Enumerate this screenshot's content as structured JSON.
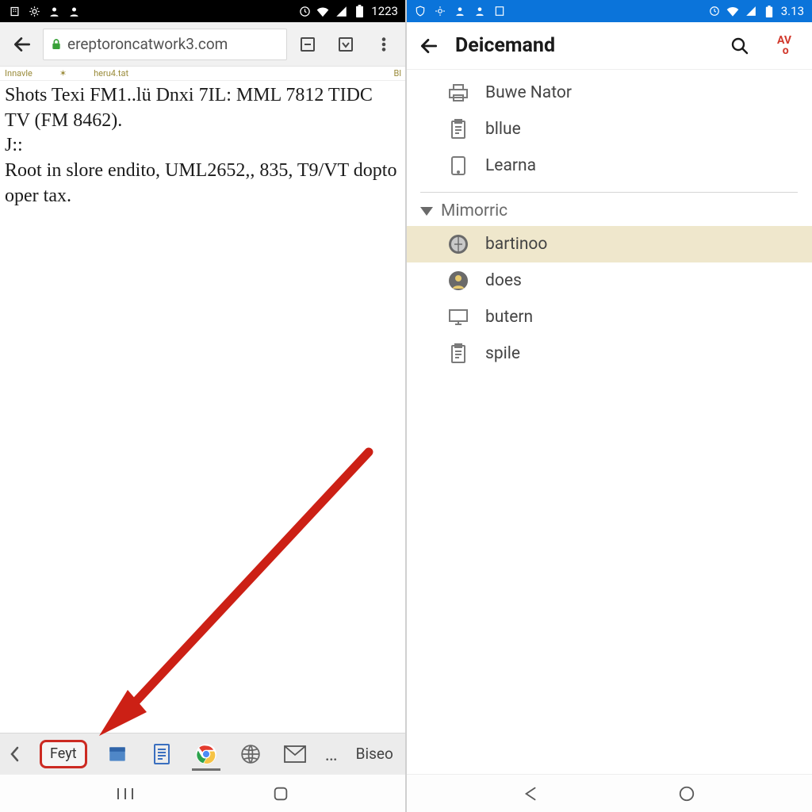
{
  "left": {
    "status": {
      "time": "1223"
    },
    "chrome": {
      "url": "ereptoroncatwork3.com"
    },
    "ribbon": {
      "a": "Innavle",
      "b": "heru4.tat",
      "r": "Bl"
    },
    "page": {
      "l1": "Shots Texi FM1..lü Dnxi 7IL: MML 7812 TIDC TV (FM 8462).",
      "l2": "J::",
      "l3": "Root in slore endito, UML2652,, 835, T9/VT dopto oper tax."
    },
    "taskbar": {
      "feyt": "Feyt",
      "more": "Biseo"
    }
  },
  "right": {
    "status": {
      "time": "3.13"
    },
    "appbar": {
      "title": "Deicemand"
    },
    "section1": [
      {
        "icon": "printer-icon",
        "label": "Buwe Nator"
      },
      {
        "icon": "clipboard-icon",
        "label": "bllue"
      },
      {
        "icon": "tablet-icon",
        "label": "Learna"
      }
    ],
    "section2_title": "Mimorric",
    "section2": [
      {
        "icon": "compass-icon",
        "label": "bartinoo",
        "hl": true
      },
      {
        "icon": "avatar-icon",
        "label": "does"
      },
      {
        "icon": "monitor-icon",
        "label": "butern"
      },
      {
        "icon": "clipboard-icon",
        "label": "spile"
      }
    ]
  }
}
